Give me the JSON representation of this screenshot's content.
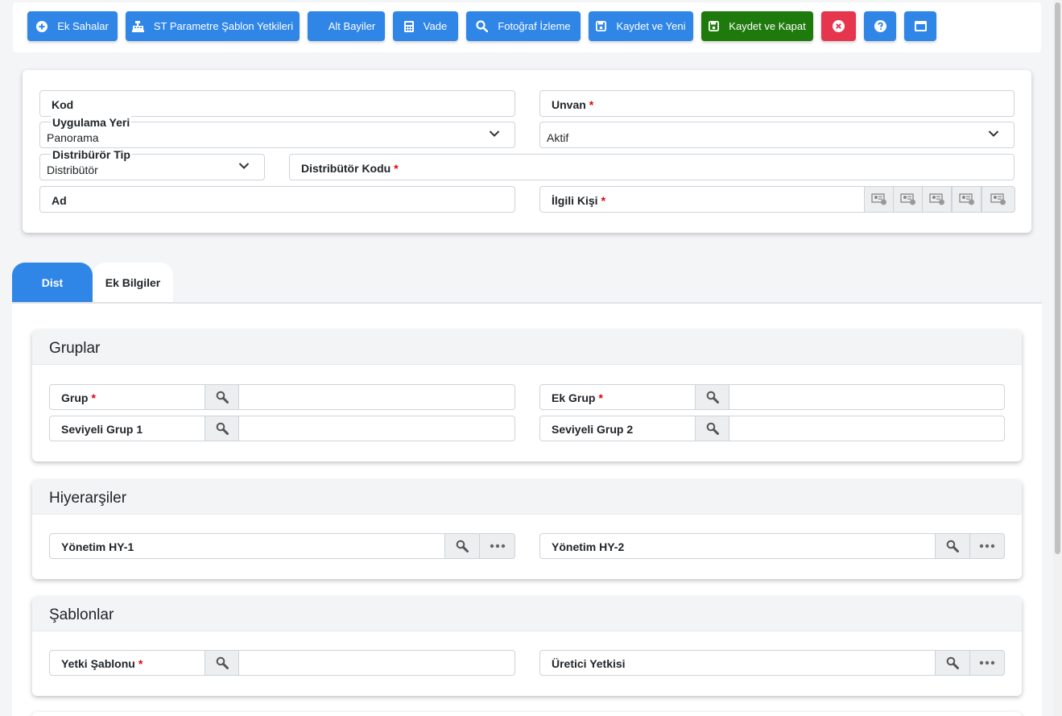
{
  "toolbar": {
    "ek_sahalar": "Ek Sahalar",
    "st_parametre": "ST Parametre Şablon Yetkileri",
    "alt_bayiler": "Alt Bayiler",
    "vade": "Vade",
    "fotograf": "Fotoğraf İzleme",
    "kaydet_yeni": "Kaydet ve Yeni",
    "kaydet_kapat": "Kaydet ve Kapat",
    "colors": {
      "primary": "#2f86e7",
      "success": "#1f7a0d",
      "danger": "#e5364e"
    }
  },
  "header": {
    "kod": {
      "label": "Kod"
    },
    "unvan": {
      "label": "Unvan",
      "required": "*"
    },
    "uygulama_yeri": {
      "label": "Uygulama Yeri",
      "value": "Panorama"
    },
    "durum": {
      "value": "Aktif"
    },
    "distributor_tip": {
      "label": "Distribürör Tip",
      "value": "Distribütör"
    },
    "distributor_kodu": {
      "label": "Distribütör Kodu",
      "required": "*"
    },
    "ad": {
      "label": "Ad"
    },
    "ilgili_kisi": {
      "label": "İlgili Kişi",
      "required": "*"
    }
  },
  "tabs": [
    {
      "label": "Dist",
      "active": true
    },
    {
      "label": "Ek Bilgiler",
      "active": false
    }
  ],
  "gruplar": {
    "title": "Gruplar",
    "grup": {
      "label": "Grup",
      "required": "*"
    },
    "ek_grup": {
      "label": "Ek Grup",
      "required": "*"
    },
    "seviyeli_grup_1": {
      "label": "Seviyeli Grup 1"
    },
    "seviyeli_grup_2": {
      "label": "Seviyeli Grup 2"
    }
  },
  "hiyerarsiler": {
    "title": "Hiyerarşiler",
    "hy1": {
      "label": "Yönetim HY-1"
    },
    "hy2": {
      "label": "Yönetim HY-2"
    }
  },
  "sablonlar": {
    "title": "Şablonlar",
    "yetki_sablonu": {
      "label": "Yetki Şablonu",
      "required": "*"
    },
    "uretici_yetkisi": {
      "label": "Üretici Yetkisi"
    }
  },
  "icons": [
    "plus-circle-icon",
    "cash-register-icon",
    "calculator-icon",
    "search-icon",
    "save-icon",
    "close-circle-icon",
    "help-icon",
    "window-icon",
    "chevron-down-icon",
    "contact-card-icon",
    "ellipsis-icon"
  ]
}
